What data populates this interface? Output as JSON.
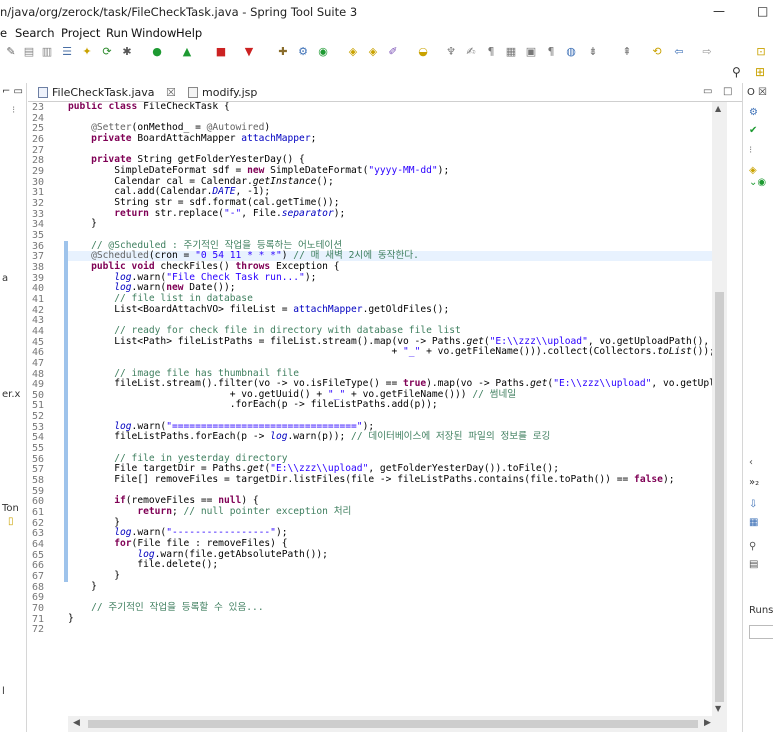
{
  "window": {
    "title": "n/java/org/zerock/task/FileCheckTask.java - Spring Tool Suite 3",
    "minimize": "—",
    "maximize": "□"
  },
  "menu": [
    "e",
    "Search",
    "Project",
    "Run",
    "Window",
    "Help"
  ],
  "editor": {
    "tabs": [
      {
        "label": "FileCheckTask.java",
        "close": "☒"
      },
      {
        "label": "modify.jsp"
      }
    ]
  },
  "left_pane_labels": {
    "a": "a",
    "er": "er.x",
    "ton": "Ton",
    "l": "l"
  },
  "right_pane_labels": {
    "runs": "Runs"
  },
  "code": {
    "first_line": 23,
    "lines": [
      "public class FileCheckTask {",
      "",
      "    @Setter(onMethod_ = @Autowired)",
      "    private BoardAttachMapper attachMapper;",
      "",
      "    private String getFolderYesterDay() {",
      "        SimpleDateFormat sdf = new SimpleDateFormat(\"yyyy-MM-dd\");",
      "        Calendar cal = Calendar.getInstance();",
      "        cal.add(Calendar.DATE, -1);",
      "        String str = sdf.format(cal.getTime());",
      "        return str.replace(\"-\", File.separator);",
      "    }",
      "",
      "    // @Scheduled : 주기적인 작업을 등록하는 어노테이션",
      "    @Scheduled(cron = \"0 54 11 * * *\") // 매 새벽 2시에 동작한다.",
      "    public void checkFiles() throws Exception {",
      "        log.warn(\"File Check Task run...\");",
      "        log.warn(new Date());",
      "        // file list in database",
      "        List<BoardAttachVO> fileList = attachMapper.getOldFiles();",
      "",
      "        // ready for check file in directory with database file list",
      "        List<Path> fileListPaths = fileList.stream().map(vo -> Paths.get(\"E:\\\\zzz\\\\upload\", vo.getUploadPath(), v",
      "                                                        + \"_\" + vo.getFileName())).collect(Collectors.toList());",
      "",
      "        // image file has thumbnail file",
      "        fileList.stream().filter(vo -> vo.isFileType() == true).map(vo -> Paths.get(\"E:\\\\zzz\\\\upload\", vo.getUplo",
      "                            + vo.getUuid() + \"_\" + vo.getFileName())) // 썸네일",
      "                            .forEach(p -> fileListPaths.add(p));",
      "",
      "        log.warn(\"================================\");",
      "        fileListPaths.forEach(p -> log.warn(p)); // 데이터베이스에 저장된 파일의 정보를 로깅",
      "",
      "        // file in yesterday directory",
      "        File targetDir = Paths.get(\"E:\\\\zzz\\\\upload\", getFolderYesterDay()).toFile();",
      "        File[] removeFiles = targetDir.listFiles(file -> fileListPaths.contains(file.toPath()) == false);",
      "",
      "        if(removeFiles == null) {",
      "            return; // null pointer exception 처리",
      "        }",
      "        log.warn(\"-----------------\");",
      "        for(File file : removeFiles) {",
      "            log.warn(file.getAbsolutePath());",
      "            file.delete();",
      "        }",
      "    }",
      "",
      "    // 주기적인 작업을 등록할 수 있음...",
      "}",
      ""
    ]
  },
  "colors": {
    "keyword": "#7f0055",
    "string": "#2a00ff",
    "comment": "#3f7f5f",
    "annotation": "#646464",
    "field": "#0000c0",
    "current_line": "#e8f2fe",
    "change_bar": "#9ec3eb"
  }
}
